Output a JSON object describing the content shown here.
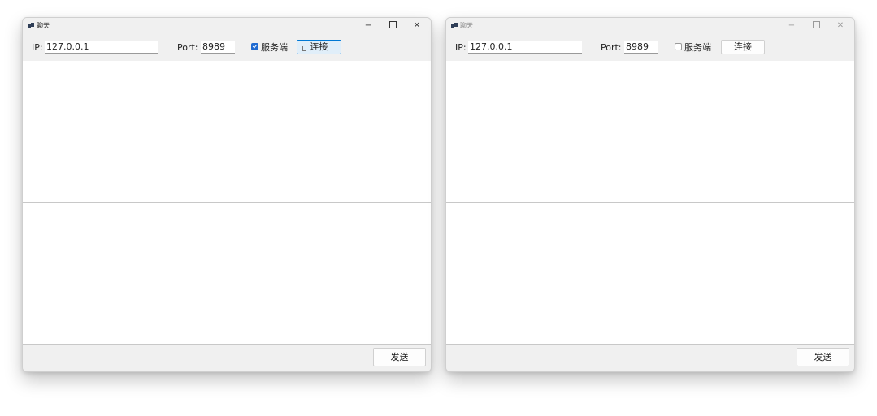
{
  "windows": [
    {
      "title": "聊天",
      "controls": {
        "minimize": "−",
        "close": "✕"
      },
      "ip_label": "IP:",
      "ip_value": "127.0.0.1",
      "port_label": "Port:",
      "port_value": "8989",
      "server_checkbox_label": "服务端",
      "server_checked": true,
      "connect_label": "连接",
      "send_label": "发送"
    },
    {
      "title": "聊天",
      "controls": {
        "minimize": "−",
        "close": "✕"
      },
      "ip_label": "IP:",
      "ip_value": "127.0.0.1",
      "port_label": "Port:",
      "port_value": "8989",
      "server_checkbox_label": "服务端",
      "server_checked": false,
      "connect_label": "连接",
      "send_label": "发送"
    }
  ],
  "colors": {
    "accent": "#1f6ad1",
    "hover_border": "#0078d4",
    "hover_fill": "#e0eef9",
    "chrome": "#f0f0f0"
  }
}
